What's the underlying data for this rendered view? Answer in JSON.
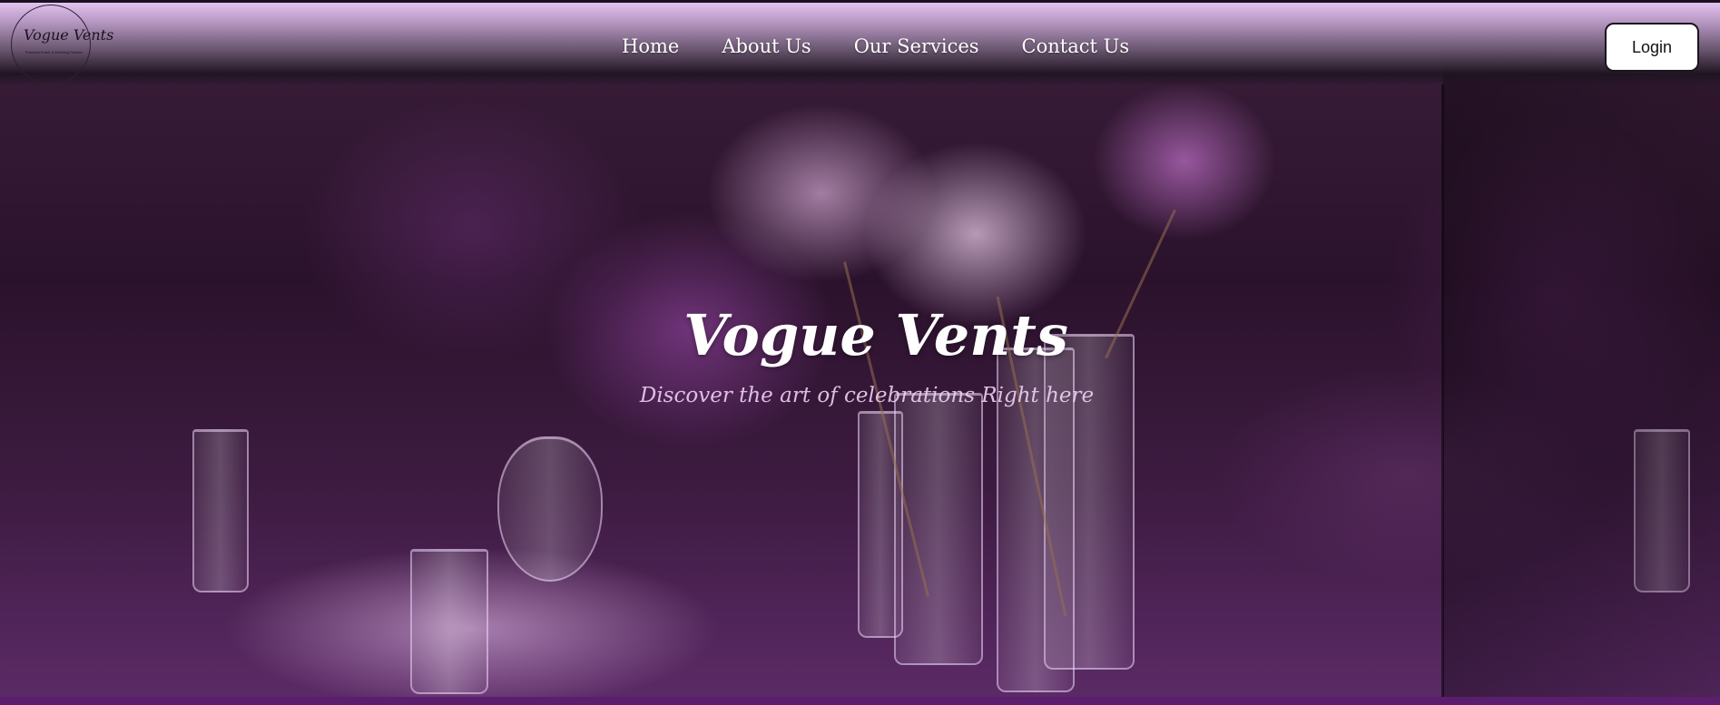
{
  "brand": {
    "logo_title": "Vogue Vents",
    "logo_tagline": "Premium Event & Wedding Planner"
  },
  "nav": {
    "items": [
      {
        "label": "Home"
      },
      {
        "label": "About Us"
      },
      {
        "label": "Our Services"
      },
      {
        "label": "Contact Us"
      }
    ],
    "login_label": "Login"
  },
  "hero": {
    "title": "Vogue Vents",
    "subtitle": "Discover the art of celebrations Right here"
  },
  "colors": {
    "navbar_top": "#e2c3ef",
    "accent_purple": "#5b1e6e",
    "login_bg": "#ffffff"
  }
}
